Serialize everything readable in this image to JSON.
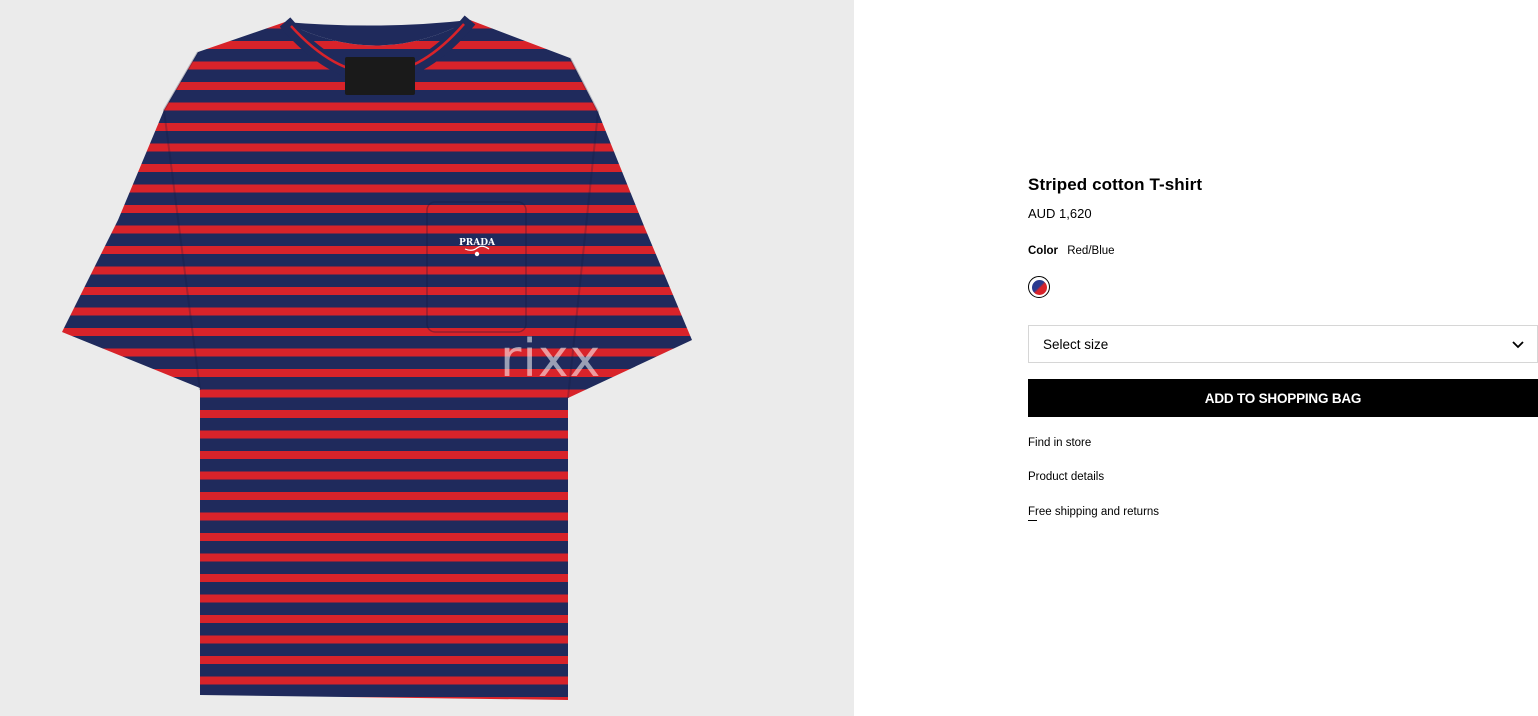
{
  "gallery": {
    "image_name": "striped-t-shirt-image",
    "logo_text": "PRADA",
    "watermark": "rixx",
    "colors": {
      "navy": "#1f2a5c",
      "red": "#d8232a",
      "background": "#ebebeb"
    }
  },
  "product": {
    "title": "Striped cotton T-shirt",
    "price": "AUD 1,620"
  },
  "color": {
    "label": "Color",
    "value": "Red/Blue"
  },
  "size": {
    "placeholder": "Select size",
    "icon": "chevron-down-icon"
  },
  "actions": {
    "add_to_bag": "ADD TO SHOPPING BAG"
  },
  "links": {
    "find_in_store": "Find in store",
    "product_details": "Product details",
    "shipping": "Free shipping and returns"
  }
}
